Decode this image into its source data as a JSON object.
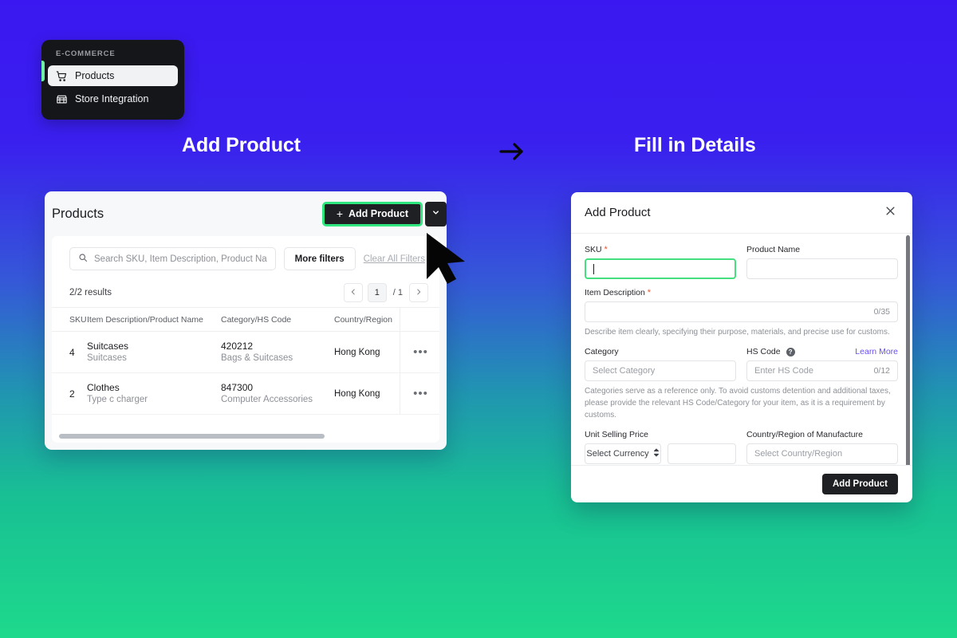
{
  "sidebar": {
    "section_label": "E-COMMERCE",
    "items": [
      {
        "label": "Products",
        "icon": "shopping-cart-icon",
        "active": true
      },
      {
        "label": "Store Integration",
        "icon": "storefront-icon",
        "active": false
      }
    ]
  },
  "steps": {
    "step1_title": "Add Product",
    "step2_title": "Fill in Details",
    "arrow_icon": "arrow-right-icon"
  },
  "products_panel": {
    "title": "Products",
    "add_button_label": "Add Product",
    "add_button_plus": "+",
    "dropdown_icon": "chevron-down-icon",
    "search_placeholder": "Search SKU, Item Description, Product Na",
    "search_icon": "search-icon",
    "more_filters_label": "More filters",
    "clear_filters_label": "Clear All Filters",
    "results_text": "2/2 results",
    "pagination": {
      "prev_icon": "chevron-left-icon",
      "next_icon": "chevron-right-icon",
      "current_page": "1",
      "total_pages": "/ 1"
    },
    "columns": [
      "SKU",
      "Item Description/Product Name",
      "Category/HS Code",
      "Country/Region",
      ""
    ],
    "rows": [
      {
        "sku": "4",
        "description": "Suitcases",
        "product_name": "Suitcases",
        "hs_code": "420212",
        "category": "Bags & Suitcases",
        "country": "Hong Kong",
        "actions_icon": "more-horizontal-icon",
        "actions_label": "•••"
      },
      {
        "sku": "2",
        "description": "Clothes",
        "product_name": "Type c charger",
        "hs_code": "847300",
        "category": "Computer Accessories",
        "country": "Hong Kong",
        "actions_icon": "more-horizontal-icon",
        "actions_label": "•••"
      }
    ]
  },
  "dialog": {
    "title": "Add Product",
    "close_icon": "close-icon",
    "fields": {
      "sku_label": "SKU",
      "sku_required": "*",
      "sku_value": "",
      "product_name_label": "Product Name",
      "product_name_value": "",
      "item_description_label": "Item Description",
      "item_description_required": "*",
      "item_description_counter": "0/35",
      "item_description_hint": "Describe item clearly, specifying their purpose, materials, and precise use for customs.",
      "category_label": "Category",
      "category_placeholder": "Select Category",
      "hs_code_label": "HS Code",
      "hs_code_help_icon": "help-circle-icon",
      "hs_code_placeholder": "Enter HS Code",
      "hs_code_counter": "0/12",
      "learn_more_label": "Learn More",
      "category_hint": "Categories serve as a reference only. To avoid customs detention and additional taxes, please provide the relevant HS Code/Category for your item, as it is a requirement by customs.",
      "unit_selling_price_label": "Unit Selling Price",
      "currency_placeholder": "Select Currency",
      "currency_icon": "updown-arrows-icon",
      "price_value": "",
      "country_label": "Country/Region of Manufacture",
      "country_placeholder": "Select Country/Region"
    },
    "submit_label": "Add Product"
  },
  "cursor": {
    "icon": "mouse-pointer-icon"
  },
  "colors": {
    "accent_green": "#2ee87f",
    "sidebar_accent": "#6ef0a5",
    "dark": "#1f2024",
    "link_purple": "#6a4ef7",
    "required_red": "#f0542d",
    "bg_top": "#3a17f0",
    "bg_bottom": "#1ed98c"
  }
}
